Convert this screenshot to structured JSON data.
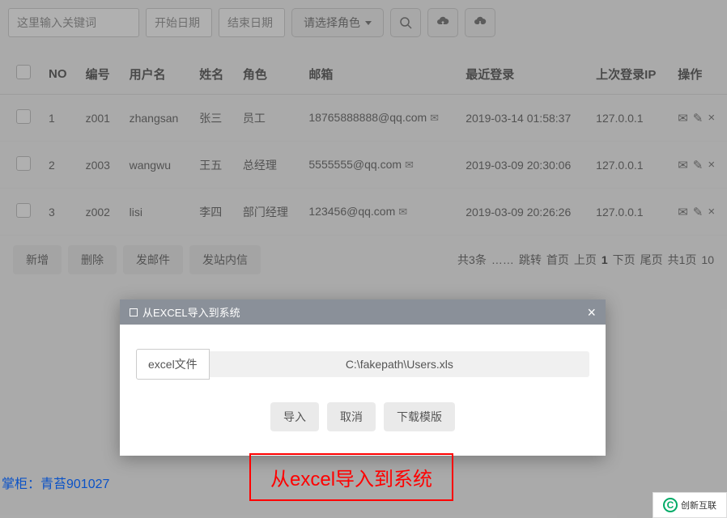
{
  "toolbar": {
    "keyword_placeholder": "这里输入关键词",
    "start_date_placeholder": "开始日期",
    "end_date_placeholder": "结束日期",
    "role_select": "请选择角色"
  },
  "table": {
    "headers": {
      "no": "NO",
      "code": "编号",
      "username": "用户名",
      "name": "姓名",
      "role": "角色",
      "email": "邮箱",
      "last_login": "最近登录",
      "last_ip": "上次登录IP",
      "ops": "操作"
    },
    "rows": [
      {
        "no": "1",
        "code": "z001",
        "username": "zhangsan",
        "name": "张三",
        "role": "员工",
        "email": "18765888888@qq.com",
        "last_login": "2019-03-14 01:58:37",
        "last_ip": "127.0.0.1"
      },
      {
        "no": "2",
        "code": "z003",
        "username": "wangwu",
        "name": "王五",
        "role": "总经理",
        "email": "5555555@qq.com",
        "last_login": "2019-03-09 20:30:06",
        "last_ip": "127.0.0.1"
      },
      {
        "no": "3",
        "code": "z002",
        "username": "lisi",
        "name": "李四",
        "role": "部门经理",
        "email": "123456@qq.com",
        "last_login": "2019-03-09 20:26:26",
        "last_ip": "127.0.0.1"
      }
    ]
  },
  "buttons": {
    "add": "新增",
    "delete": "删除",
    "send_mail": "发邮件",
    "send_msg": "发站内信"
  },
  "pagination": {
    "total_text": "共3条",
    "separator": "……",
    "jump": "跳转",
    "first": "首页",
    "prev": "上页",
    "current": "1",
    "next": "下页",
    "last": "尾页",
    "pages": "共1页",
    "size": "10"
  },
  "modal": {
    "title": "从EXCEL导入到系统",
    "file_label": "excel文件",
    "file_path": "C:\\fakepath\\Users.xls",
    "import": "导入",
    "cancel": "取消",
    "download": "下载模版"
  },
  "annotation": "从excel导入到系统",
  "footer_text": "掌柜：青苔901027",
  "logo_text": "创新互联"
}
